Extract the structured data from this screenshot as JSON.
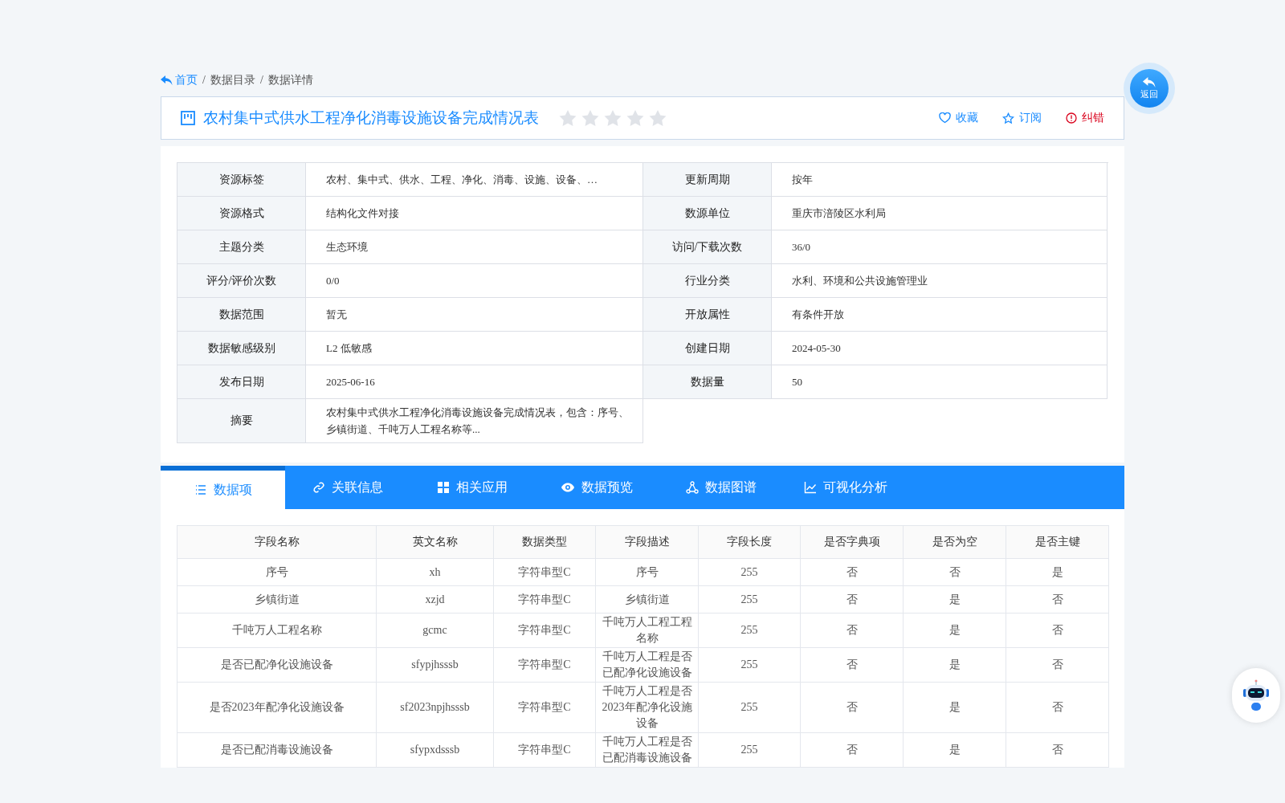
{
  "breadcrumb": [
    {
      "label": "首页",
      "kind": "home"
    },
    {
      "label": "数据目录",
      "kind": "crumb",
      "separator": "/"
    },
    {
      "label": "数据详情",
      "kind": "crumb",
      "separator": "/"
    }
  ],
  "header": {
    "title": "农村集中式供水工程净化消毒设施设备完成情况表",
    "stars": 0,
    "actions": [
      {
        "label": "收藏",
        "kind": "favorite"
      },
      {
        "label": "订阅",
        "kind": "subscribe"
      },
      {
        "label": "纠错",
        "kind": "report"
      }
    ]
  },
  "back_button": {
    "label": "返回"
  },
  "info": [
    {
      "label": "资源标签",
      "value": "农村、集中式、供水、工程、净化、消毒、设施、设备、…"
    },
    {
      "label": "更新周期",
      "value": "按年"
    },
    {
      "label": "资源格式",
      "value": "结构化文件对接"
    },
    {
      "label": "数源单位",
      "value": "重庆市涪陵区水利局"
    },
    {
      "label": "主题分类",
      "value": "生态环境"
    },
    {
      "label": "访问/下载次数",
      "value": "36/0"
    },
    {
      "label": "评分/评价次数",
      "value": "0/0"
    },
    {
      "label": "行业分类",
      "value": "水利、环境和公共设施管理业"
    },
    {
      "label": "数据范围",
      "value": "暂无"
    },
    {
      "label": "开放属性",
      "value": "有条件开放"
    },
    {
      "label": "数据敏感级别",
      "value": "L2 低敏感"
    },
    {
      "label": "创建日期",
      "value": "2024-05-30"
    },
    {
      "label": "发布日期",
      "value": "2025-06-16"
    },
    {
      "label": "数据量",
      "value": "50"
    },
    {
      "label": "摘要",
      "value": "农村集中式供水工程净化消毒设施设备完成情况表，包含：序号、乡镇街道、千吨万人工程名称等..."
    }
  ],
  "tabs": [
    {
      "label": "数据项",
      "kind": "list",
      "selected": true
    },
    {
      "label": "关联信息",
      "kind": "link",
      "selected": false
    },
    {
      "label": "相关应用",
      "kind": "apps",
      "selected": false
    },
    {
      "label": "数据预览",
      "kind": "preview",
      "selected": false
    },
    {
      "label": "数据图谱",
      "kind": "graph",
      "selected": false
    },
    {
      "label": "可视化分析",
      "kind": "chart",
      "selected": false
    }
  ],
  "table": {
    "columns": [
      "字段名称",
      "英文名称",
      "数据类型",
      "字段描述",
      "字段长度",
      "是否字典项",
      "是否为空",
      "是否主键"
    ],
    "rows": [
      [
        "序号",
        "xh",
        "字符串型C",
        "序号",
        "255",
        "否",
        "否",
        "是"
      ],
      [
        "乡镇街道",
        "xzjd",
        "字符串型C",
        "乡镇街道",
        "255",
        "否",
        "是",
        "否"
      ],
      [
        "千吨万人工程名称",
        "gcmc",
        "字符串型C",
        "千吨万人工程工程名称",
        "255",
        "否",
        "是",
        "否"
      ],
      [
        "是否已配净化设施设备",
        "sfypjhsssb",
        "字符串型C",
        "千吨万人工程是否已配净化设施设备",
        "255",
        "否",
        "是",
        "否"
      ],
      [
        "是否2023年配净化设施设备",
        "sf2023npjhsssb",
        "字符串型C",
        "千吨万人工程是否2023年配净化设施设备",
        "255",
        "否",
        "是",
        "否"
      ],
      [
        "是否已配消毒设施设备",
        "sfypxdsssb",
        "字符串型C",
        "千吨万人工程是否已配消毒设施设备",
        "255",
        "否",
        "是",
        "否"
      ]
    ]
  }
}
